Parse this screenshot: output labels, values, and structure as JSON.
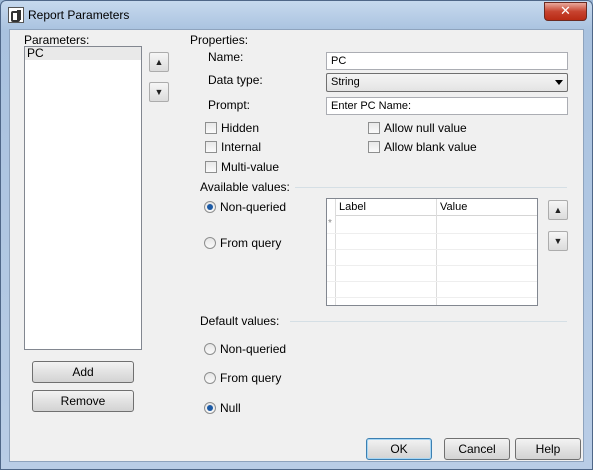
{
  "window": {
    "title": "Report Parameters",
    "close_glyph": "✕"
  },
  "parameters": {
    "label": "Parameters:",
    "items": [
      "PC"
    ],
    "up_glyph": "▲",
    "down_glyph": "▼",
    "add_label": "Add",
    "remove_label": "Remove"
  },
  "properties": {
    "group_label": "Properties:",
    "name_label": "Name:",
    "name_value": "PC",
    "data_type_label": "Data type:",
    "data_type_value": "String",
    "prompt_label": "Prompt:",
    "prompt_value": "Enter PC Name:",
    "hidden_label": "Hidden",
    "internal_label": "Internal",
    "multi_value_label": "Multi-value",
    "allow_null_label": "Allow null value",
    "allow_blank_label": "Allow blank value"
  },
  "available_values": {
    "group_label": "Available values:",
    "non_queried_label": "Non-queried",
    "from_query_label": "From query",
    "selected": "non-queried",
    "grid_headers": [
      "Label",
      "Value"
    ],
    "new_row_marker": "*",
    "up_glyph": "▲",
    "down_glyph": "▼"
  },
  "default_values": {
    "group_label": "Default values:",
    "non_queried_label": "Non-queried",
    "from_query_label": "From query",
    "null_label": "Null",
    "selected": "null"
  },
  "buttons": {
    "ok": "OK",
    "cancel": "Cancel",
    "help": "Help"
  }
}
